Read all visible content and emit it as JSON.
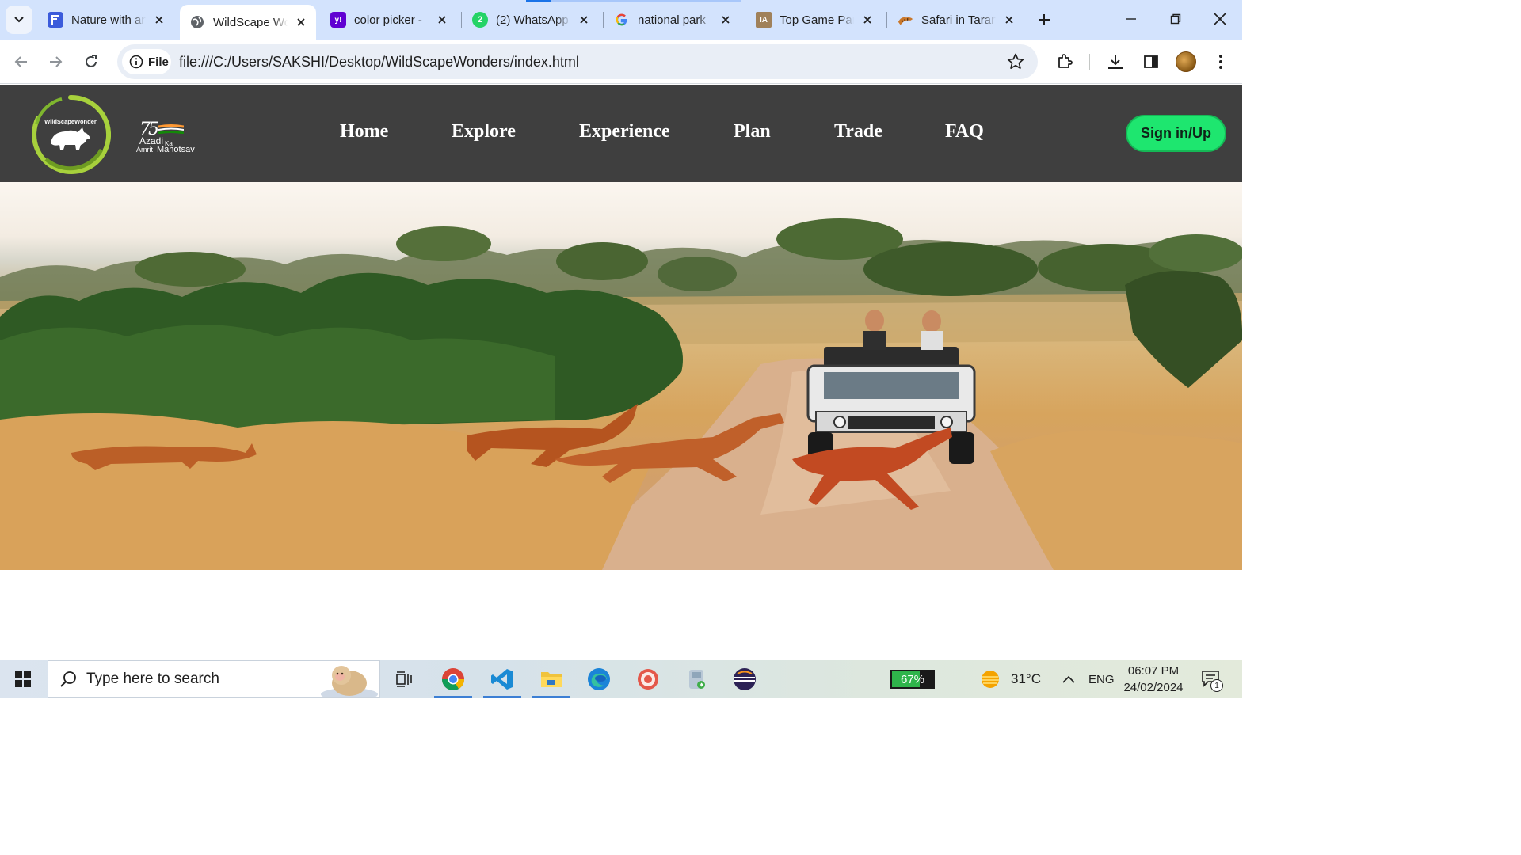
{
  "browser": {
    "tabs": [
      {
        "title": "Nature with an",
        "favicon": "F",
        "favicon_color": "#3b5bdb",
        "active": false
      },
      {
        "title": "WildScape Wo",
        "favicon": "globe",
        "favicon_color": "#5f6368",
        "active": true
      },
      {
        "title": "color picker -",
        "favicon": "y!",
        "favicon_color": "#6001d2",
        "active": false
      },
      {
        "title": "(2) WhatsApp",
        "favicon": "2",
        "favicon_color": "#25d366",
        "active": false
      },
      {
        "title": "national park",
        "favicon": "G",
        "favicon_color": "#4285f4",
        "active": false
      },
      {
        "title": "Top Game Par",
        "favicon": "IA",
        "favicon_color": "#a0815a",
        "active": false
      },
      {
        "title": "Safari in Taran",
        "favicon": "tiger",
        "favicon_color": "#c9772a",
        "active": false
      }
    ],
    "address": {
      "chip_label": "File",
      "url": "file:///C:/Users/SAKSHI/Desktop/WildScapeWonders/index.html"
    }
  },
  "site": {
    "logo_text": "WildScapeWonder",
    "badge": {
      "number": "75",
      "line1": "Azadi",
      "line2": "Ka",
      "line3": "Amrit",
      "line4": "Mahotsav"
    },
    "nav": [
      "Home",
      "Explore",
      "Experience",
      "Plan",
      "Trade",
      "FAQ"
    ],
    "signin_label": "Sign in/Up",
    "colors": {
      "header_bg": "#3f3f3f",
      "signin_bg": "#1ee66f",
      "logo_ring": "#9ccc3a"
    }
  },
  "taskbar": {
    "search_placeholder": "Type here to search",
    "battery_percent": "67%",
    "battery_level": 0.67,
    "temperature": "31°C",
    "language": "ENG",
    "time": "06:07 PM",
    "date": "24/02/2024",
    "notification_count": "1"
  }
}
